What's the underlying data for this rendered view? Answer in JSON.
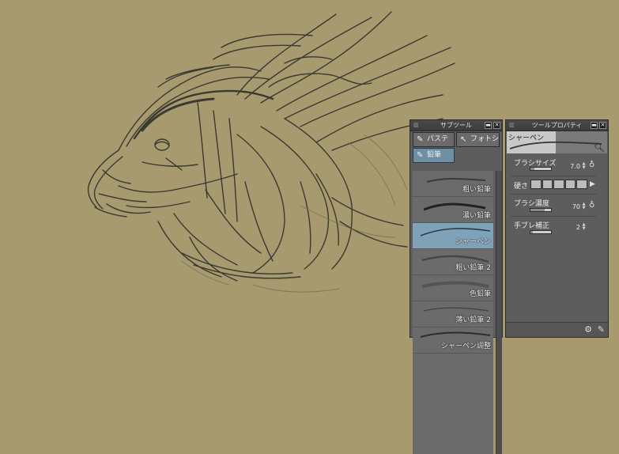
{
  "sub_tool": {
    "title": "サブツール",
    "tabs": [
      {
        "label": "パステル",
        "icon": "pastel-icon"
      },
      {
        "label": "フォトショ",
        "icon": "photoshop-brush-icon"
      },
      {
        "label": "鉛筆",
        "icon": "pencil-icon"
      }
    ],
    "items": [
      {
        "label": "粗い鉛筆"
      },
      {
        "label": "濃い鉛筆"
      },
      {
        "label": "シャーペン"
      },
      {
        "label": "粗い鉛筆 2"
      },
      {
        "label": "色鉛筆"
      },
      {
        "label": "薄い鉛筆 2"
      },
      {
        "label": "シャーペン調整"
      }
    ],
    "selected_index": 2
  },
  "tool_property": {
    "title": "ツールプロパティ",
    "preview_label": "シャーペン",
    "props": [
      {
        "label": "ブラシサイズ",
        "value": "7.0",
        "fill": 0.18
      },
      {
        "label": "硬さ",
        "value": "",
        "segments_filled": 5
      },
      {
        "label": "ブラシ濃度",
        "value": "70",
        "fill": 0.7
      },
      {
        "label": "手ブレ補正",
        "value": "2",
        "fill": 0.1
      }
    ]
  },
  "colors": {
    "canvas_bg": "#a89a6f",
    "panel_bg": "#5d5d5d",
    "selected": "#80a2b8",
    "active_tab": "#6d8ea3"
  }
}
